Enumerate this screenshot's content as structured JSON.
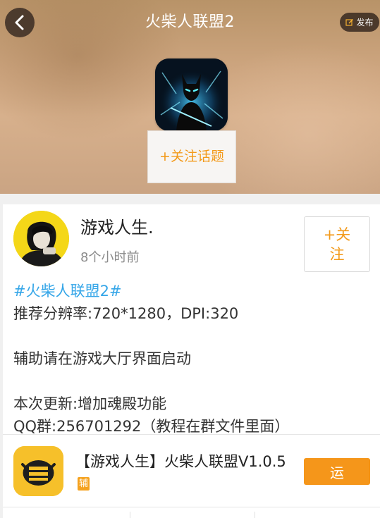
{
  "header": {
    "title": "火柴人联盟2",
    "post_label": "发布",
    "follow_topic_label": "+关注话题",
    "game_icon": "stickman-league-2-game-icon"
  },
  "post": {
    "author": "游戏人生.",
    "time": "8个小时前",
    "follow_label": "+关注",
    "topic_tag": "#火柴人联盟2#",
    "lines": [
      "推荐分辨率:720*1280，DPI:320",
      "",
      "辅助请在游戏大厅界面启动",
      "",
      "本次更新:增加魂殿功能",
      "QQ群:256701292（教程在群文件里面）"
    ]
  },
  "app": {
    "name": "【游戏人生】火柴人联盟V1.0.5",
    "badge": "辅",
    "run_label": "运"
  },
  "colors": {
    "accent_orange": "#f39a1a",
    "topic_blue": "#35a6e8",
    "run_button": "#f5961a",
    "app_icon_yellow": "#f6c02a"
  },
  "icons": {
    "back": "chevron-left-icon",
    "post": "edit-icon"
  }
}
